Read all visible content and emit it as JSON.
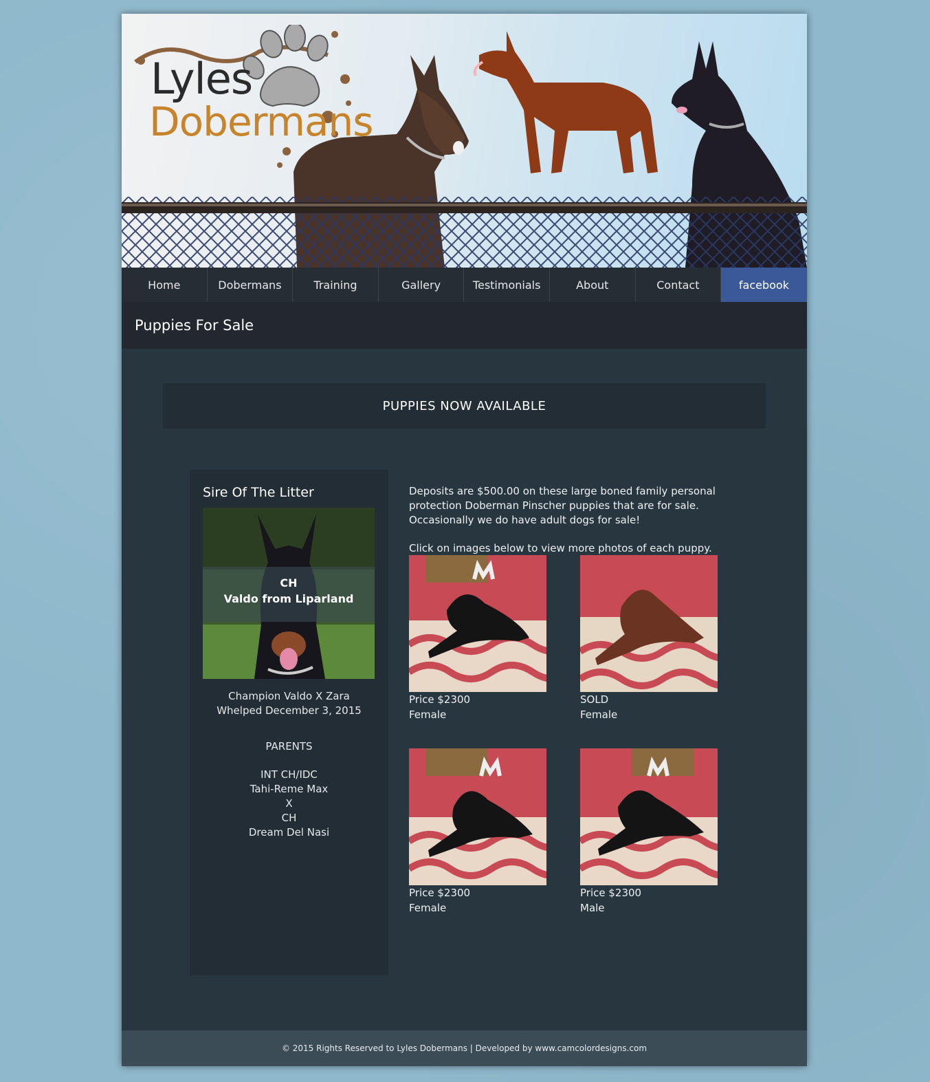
{
  "header": {
    "logo_line1": "Lyles",
    "logo_line2": "Dobermans"
  },
  "nav": {
    "items": [
      {
        "label": "Home"
      },
      {
        "label": "Dobermans"
      },
      {
        "label": "Training"
      },
      {
        "label": "Gallery"
      },
      {
        "label": "Testimonials"
      },
      {
        "label": "About"
      },
      {
        "label": "Contact"
      },
      {
        "label": "facebook"
      }
    ]
  },
  "page": {
    "title": "Puppies For Sale",
    "banner": "PUPPIES NOW AVAILABLE"
  },
  "sidebar": {
    "heading": "Sire Of The Litter",
    "photo_caption_line1": "CH",
    "photo_caption_line2": "Valdo from Liparland",
    "litter_line1": "Champion Valdo X Zara",
    "litter_line2": "Whelped December 3, 2015",
    "parents_heading": "PARENTS",
    "parents": [
      "INT CH/IDC",
      "Tahi-Reme Max",
      "X",
      "CH",
      "Dream Del Nasi"
    ]
  },
  "main": {
    "intro": "Deposits are $500.00 on these large boned family personal protection Doberman Pinscher puppies that are for sale. Occasionally we do have adult dogs for sale!",
    "instruction": "Click on images below to view more photos of each puppy."
  },
  "puppies": [
    {
      "price": "Price $2300",
      "sex": "Female",
      "coat": "black"
    },
    {
      "price": "SOLD",
      "sex": "Female",
      "coat": "red"
    },
    {
      "price": "Price $2300",
      "sex": "Female",
      "coat": "black"
    },
    {
      "price": "Price $2300",
      "sex": "Male",
      "coat": "black"
    }
  ],
  "footer": {
    "text": "© 2015 Rights Reserved to Lyles Dobermans | Developed by www.camcolordesigns.com"
  },
  "colors": {
    "page_bg": "#8fb8cc",
    "nav_bg": "#262d33",
    "facebook": "#3b5998",
    "content_bg": "#283640",
    "logo_accent": "#c7842b"
  }
}
